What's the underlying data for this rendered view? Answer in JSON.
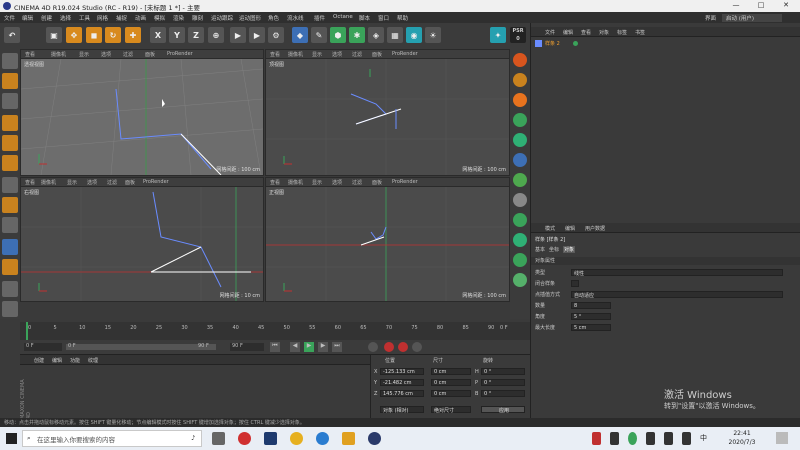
{
  "window": {
    "title": "CINEMA 4D R19.024 Studio (RC - R19) - [未标题 1 *] - 主要",
    "controls": [
      "—",
      "□",
      "✕"
    ]
  },
  "menu": [
    "文件",
    "编辑",
    "创建",
    "选择",
    "工具",
    "网格",
    "捕捉",
    "动画",
    "模拟",
    "渲染",
    "雕刻",
    "运动跟踪",
    "运动图形",
    "角色",
    "流水线",
    "插件",
    "Octane",
    "脚本",
    "窗口",
    "帮助"
  ],
  "layout": {
    "label": "界面",
    "value": "启动 (用户)"
  },
  "toolbar": {
    "axes": [
      "X",
      "Y",
      "Z"
    ]
  },
  "viewport_menu": [
    "查看",
    "摄像机",
    "显示",
    "选项",
    "过滤",
    "面板",
    "ProRender"
  ],
  "viewports": [
    {
      "name": "透视视图",
      "grid": ""
    },
    {
      "name": "顶视图",
      "grid": "网格间距 : 100 cm"
    },
    {
      "name": "右视图",
      "grid": "网格间距 : 10 cm"
    },
    {
      "name": "正视图",
      "grid": "网格间距 : 100 cm"
    }
  ],
  "perspective_grid": "网格间距 : 100 cm",
  "object_manager": {
    "menu": [
      "文件",
      "编辑",
      "查看",
      "对象",
      "标签",
      "书签"
    ],
    "objects": [
      {
        "name": "样条 2"
      }
    ]
  },
  "attribute_manager": {
    "menu": [
      "模式",
      "编辑",
      "用户数据"
    ],
    "object_label": "样条 [样条 2]",
    "tabs": [
      "基本",
      "坐标",
      "对象"
    ],
    "section": "对象属性",
    "rows": [
      {
        "label": "类型",
        "value": "线性"
      },
      {
        "label": "闭合样条",
        "value": ""
      },
      {
        "label": "点插值方式",
        "value": "自动适应"
      },
      {
        "label": "数量",
        "value": "8"
      },
      {
        "label": "角度",
        "value": "5 °"
      },
      {
        "label": "最大长度",
        "value": "5 cm"
      }
    ]
  },
  "timeline": {
    "ticks": [
      "0",
      "5",
      "10",
      "15",
      "20",
      "25",
      "30",
      "35",
      "40",
      "45",
      "50",
      "55",
      "60",
      "65",
      "70",
      "75",
      "80",
      "85",
      "90"
    ],
    "end": "0 F"
  },
  "time_controls": {
    "current": "0 F",
    "start": "0 F",
    "end": "90 F",
    "end2": "90 F"
  },
  "material_menu": [
    "创建",
    "编辑",
    "功能",
    "纹理"
  ],
  "coordinates": {
    "headers": [
      "位置",
      "尺寸",
      "旋转"
    ],
    "rows": [
      {
        "axis": "X",
        "pos": "-125.133 cm",
        "size": "0 cm",
        "rot_label": "H",
        "rot": "0 °"
      },
      {
        "axis": "Y",
        "pos": "-21.482 cm",
        "size": "0 cm",
        "rot_label": "P",
        "rot": "0 °"
      },
      {
        "axis": "Z",
        "pos": "145.776 cm",
        "size": "0 cm",
        "rot_label": "B",
        "rot": "0 °"
      }
    ],
    "mode": "对象 (相对)",
    "size_mode": "绝对尺寸",
    "apply": "应用"
  },
  "status": "移动：点击并拖动鼠标移动元素。按住 SHIFT 键量化移动；节点编辑模式时按住 SHIFT 键增加选择对象；按住 CTRL 键减少选择对象。",
  "brand": "MAXON CINEMA 4D",
  "taskbar": {
    "search_placeholder": "在这里输入你要搜索的内容",
    "time": "22:41",
    "date": "2020/7/3",
    "ime": "中"
  },
  "watermark": {
    "line1": "激活 Windows",
    "line2": "转到\"设置\"以激活 Windows。"
  },
  "colors": {
    "accent_orange": "#d88a1e",
    "accent_blue": "#3d6fb5",
    "spline_white": "#ffffff",
    "spline_blue": "#6a8cff"
  }
}
